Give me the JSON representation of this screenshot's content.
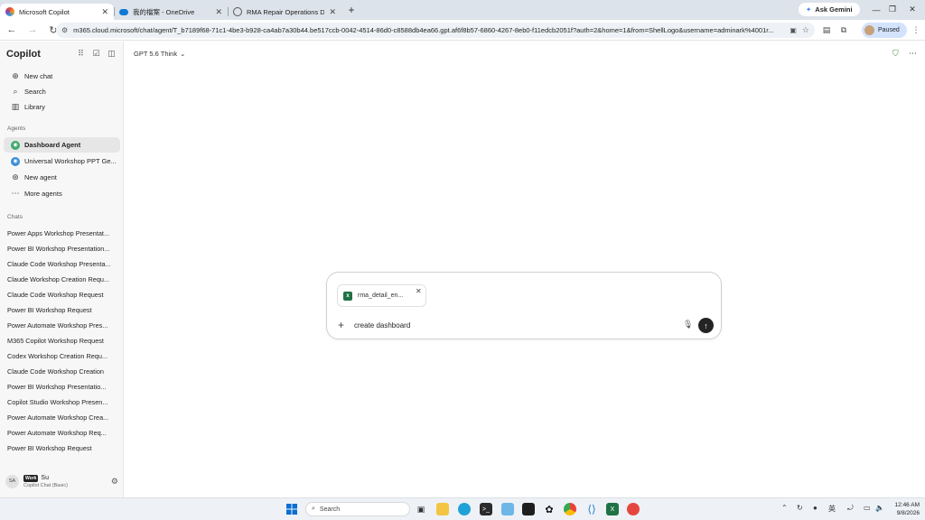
{
  "browser": {
    "tabs": [
      {
        "title": "Microsoft Copilot",
        "active": true
      },
      {
        "title": "我的檔案 - OneDrive",
        "active": false
      },
      {
        "title": "RMA Repair Operations Dashb",
        "active": false
      }
    ],
    "ask_gemini": "Ask Gemini",
    "url": "m365.cloud.microsoft/chat/agent/T_b7189f68-71c1-4be3-b928-ca4ab7a30b44.be517ccb-0042-4514-86d0-c8588db4ea66.gpt.af6f8b57-6860-4267-8eb0-f11edcb2051f?auth=2&home=1&from=ShellLogo&username=adminark%4001r...",
    "profile_status": "Paused"
  },
  "sidebar": {
    "brand": "Copilot",
    "nav": [
      {
        "label": "New chat",
        "icon": "new-chat-icon"
      },
      {
        "label": "Search",
        "icon": "search-icon"
      },
      {
        "label": "Library",
        "icon": "library-icon"
      }
    ],
    "agents_heading": "Agents",
    "agents": [
      {
        "label": "Dashboard Agent",
        "active": true
      },
      {
        "label": "Universal Workshop PPT Ge..."
      },
      {
        "label": "New agent"
      },
      {
        "label": "More agents"
      }
    ],
    "chats_heading": "Chats",
    "chats": [
      "Power Apps Workshop Presentat...",
      "Power BI Workshop Presentation...",
      "Claude Code Workshop Presenta...",
      "Claude Workshop Creation Requ...",
      "Claude Code Workshop Request",
      "Power BI Workshop Request",
      "Power Automate Workshop Pres...",
      "M365 Copilot Workshop Request",
      "Codex Workshop Creation Requ...",
      "Claude Code Workshop Creation",
      "Power BI Workshop Presentatio...",
      "Copilot Studio Workshop Presen...",
      "Power Automate Workshop Crea...",
      "Power Automate Workshop Req...",
      "Power BI Workshop Request"
    ],
    "user": {
      "initials": "SA",
      "badge": "Work",
      "name": "Su",
      "plan": "Copilot Chat (Basic)"
    }
  },
  "main": {
    "model": "GPT 5.6 Think",
    "attachment": "rma_detail_en...",
    "prompt": "create dashboard"
  },
  "taskbar": {
    "search_label": "Search",
    "ime": "英",
    "time": "12:46 AM",
    "date": "9/8/2026"
  }
}
